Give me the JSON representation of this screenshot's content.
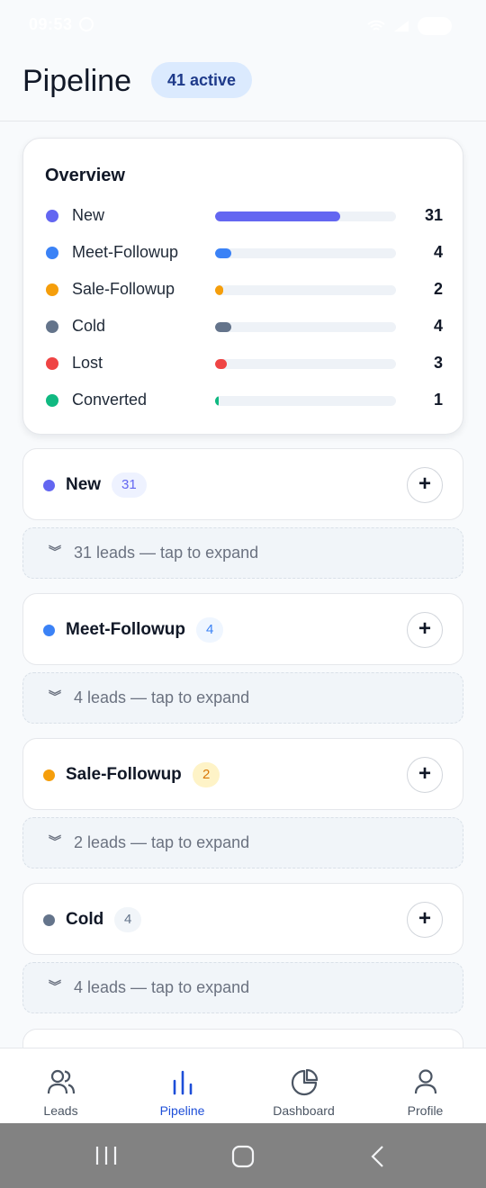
{
  "status_bar": {
    "time": "09:53",
    "battery_text": ""
  },
  "header": {
    "title": "Pipeline",
    "active_badge": "41 active"
  },
  "overview": {
    "title": "Overview",
    "rows": [
      {
        "label": "New",
        "count": "31",
        "color": "#6366f1",
        "fill_fraction": 0.69
      },
      {
        "label": "Meet-Followup",
        "count": "4",
        "color": "#3b82f6",
        "fill_fraction": 0.09
      },
      {
        "label": "Sale-Followup",
        "count": "2",
        "color": "#f59e0b",
        "fill_fraction": 0.045
      },
      {
        "label": "Cold",
        "count": "4",
        "color": "#64748b",
        "fill_fraction": 0.09
      },
      {
        "label": "Lost",
        "count": "3",
        "color": "#ef4444",
        "fill_fraction": 0.065
      },
      {
        "label": "Converted",
        "count": "1",
        "color": "#10b981",
        "fill_fraction": 0.022
      }
    ]
  },
  "stages": [
    {
      "name": "New",
      "count": "31",
      "color": "#6366f1",
      "badge_bg": "#eef2ff",
      "badge_fg": "#6366f1",
      "expand_text": "31 leads — tap to expand",
      "add_label": "+"
    },
    {
      "name": "Meet-Followup",
      "count": "4",
      "color": "#3b82f6",
      "badge_bg": "#eff6ff",
      "badge_fg": "#3b82f6",
      "expand_text": "4 leads — tap to expand",
      "add_label": "+"
    },
    {
      "name": "Sale-Followup",
      "count": "2",
      "color": "#f59e0b",
      "badge_bg": "#fef3c7",
      "badge_fg": "#d97706",
      "expand_text": "2 leads — tap to expand",
      "add_label": "+"
    },
    {
      "name": "Cold",
      "count": "4",
      "color": "#64748b",
      "badge_bg": "#f1f5f9",
      "badge_fg": "#64748b",
      "expand_text": "4 leads — tap to expand",
      "add_label": "+"
    }
  ],
  "expand_icon": "»",
  "bottom_nav": [
    {
      "label": "Leads",
      "icon": "users-icon",
      "active": false
    },
    {
      "label": "Pipeline",
      "icon": "bar-chart-icon",
      "active": true
    },
    {
      "label": "Dashboard",
      "icon": "pie-chart-icon",
      "active": false
    },
    {
      "label": "Profile",
      "icon": "user-icon",
      "active": false
    }
  ],
  "colors": {
    "accent": "#1d4ed8",
    "badge_bg": "#dbeafe"
  }
}
